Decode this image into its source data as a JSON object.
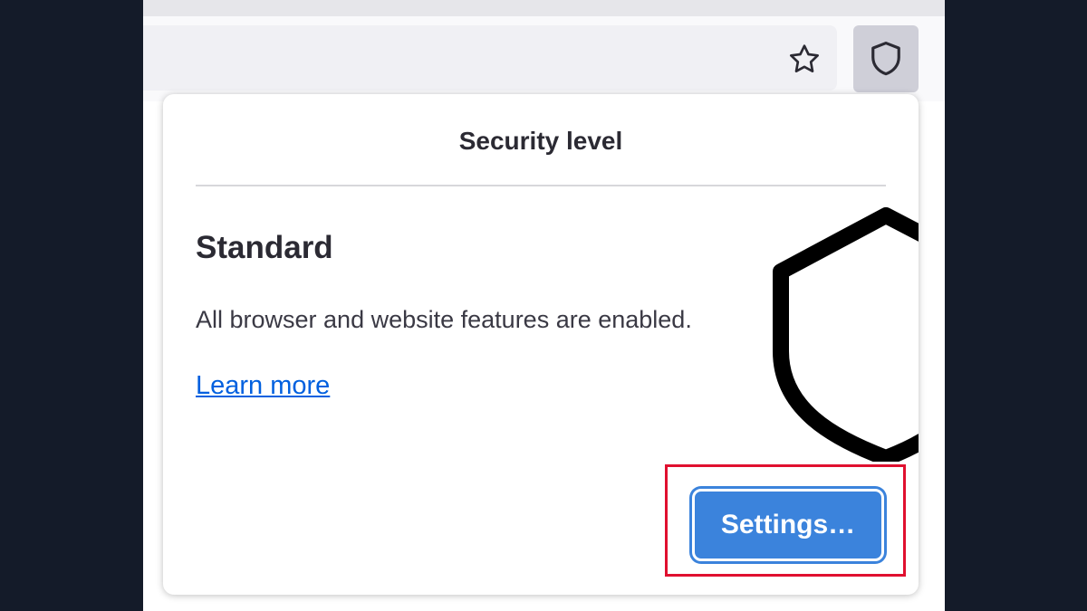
{
  "toolbar": {
    "bookmark_icon": "star-icon",
    "security_icon": "shield-icon"
  },
  "popup": {
    "title": "Security level",
    "level": "Standard",
    "description": "All browser and website features are enabled.",
    "learn_more": "Learn more",
    "settings_label": "Settings…",
    "illustration_icon": "shield-icon"
  },
  "colors": {
    "page_background": "#141b29",
    "settings_button": "#3b83dc",
    "link": "#0060df",
    "highlight": "#e0102f"
  }
}
